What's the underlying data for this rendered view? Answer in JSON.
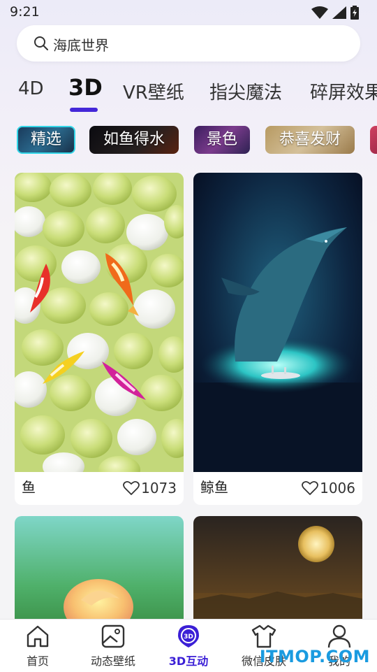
{
  "status": {
    "time": "9:21"
  },
  "search": {
    "text": "海底世界"
  },
  "tabs": [
    {
      "label": "4D",
      "active": false
    },
    {
      "label": "3D",
      "active": true
    },
    {
      "label": "VR壁纸",
      "active": false
    },
    {
      "label": "指尖魔法",
      "active": false
    },
    {
      "label": "碎屏效果",
      "active": false
    }
  ],
  "chips": [
    {
      "label": "精选",
      "selected": true
    },
    {
      "label": "如鱼得水",
      "selected": false
    },
    {
      "label": "景色",
      "selected": false
    },
    {
      "label": "恭喜发财",
      "selected": false
    }
  ],
  "cards": [
    {
      "title": "鱼",
      "likes": "1073"
    },
    {
      "title": "鲸鱼",
      "likes": "1006"
    },
    {
      "title": "",
      "likes": ""
    },
    {
      "title": "",
      "likes": ""
    }
  ],
  "nav": [
    {
      "label": "首页",
      "icon": "home-icon"
    },
    {
      "label": "动态壁纸",
      "icon": "wallpaper-icon"
    },
    {
      "label": "3D互动",
      "icon": "3d-icon",
      "active": true
    },
    {
      "label": "微信皮肤",
      "icon": "shirt-icon"
    },
    {
      "label": "我的",
      "icon": "profile-icon"
    }
  ],
  "watermark": "ITMOP.COM",
  "colors": {
    "accent": "#4427d8",
    "chip_border": "#33d6e8",
    "watermark": "#1a9be0"
  }
}
